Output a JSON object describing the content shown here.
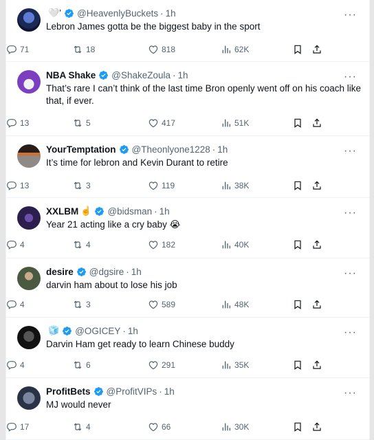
{
  "tweets": [
    {
      "name": "",
      "name_emoji": "🤍’",
      "handle": "@HeavenlyBuckets",
      "time": "1h",
      "text": "Lebron James gotta be the biggest baby in the sport",
      "replies": "71",
      "retweets": "18",
      "likes": "818",
      "views": "62K"
    },
    {
      "name": "NBA Shake",
      "name_emoji": "",
      "handle": "@ShakeZoula",
      "time": "1h",
      "text": "That’s rare I can’t think of the last time Bron openly went off on his coach like that, if ever.",
      "replies": "13",
      "retweets": "5",
      "likes": "417",
      "views": "51K"
    },
    {
      "name": "YourTemptation",
      "name_emoji": "",
      "handle": "@Theonlyone1228",
      "time": "1h",
      "text": "It’s time for lebron and Kevin Durant to retire",
      "replies": "13",
      "retweets": "3",
      "likes": "119",
      "views": "38K"
    },
    {
      "name": "XXLBM",
      "name_emoji": "☝️",
      "handle": "@bidsman",
      "time": "1h",
      "text": "Year 21 acting like a cry baby 😭",
      "replies": "4",
      "retweets": "4",
      "likes": "182",
      "views": "40K"
    },
    {
      "name": "desire",
      "name_emoji": "",
      "handle": "@dgsire",
      "time": "1h",
      "text": "darvin ham about to lose his job",
      "replies": "4",
      "retweets": "3",
      "likes": "589",
      "views": "48K"
    },
    {
      "name": "",
      "name_emoji": "🧊",
      "handle": "@OGICEY",
      "time": "1h",
      "text": "Darvin Ham get ready to learn Chinese buddy",
      "replies": "4",
      "retweets": "6",
      "likes": "291",
      "views": "35K"
    },
    {
      "name": "ProfitBets",
      "name_emoji": "",
      "handle": "@ProfitVIPs",
      "time": "1h",
      "text": "MJ would never",
      "replies": "17",
      "retweets": "4",
      "likes": "66",
      "views": "30K"
    }
  ],
  "separator": "·",
  "more_label": "···",
  "colors": {
    "verified": "#1d9bf0",
    "muted": "#536471",
    "border": "#eff3f4"
  },
  "icons": {
    "reply": "reply-icon",
    "retweet": "retweet-icon",
    "like": "heart-icon",
    "views": "views-icon",
    "bookmark": "bookmark-icon",
    "share": "share-icon",
    "verified": "verified-badge-icon",
    "more": "more-icon"
  }
}
